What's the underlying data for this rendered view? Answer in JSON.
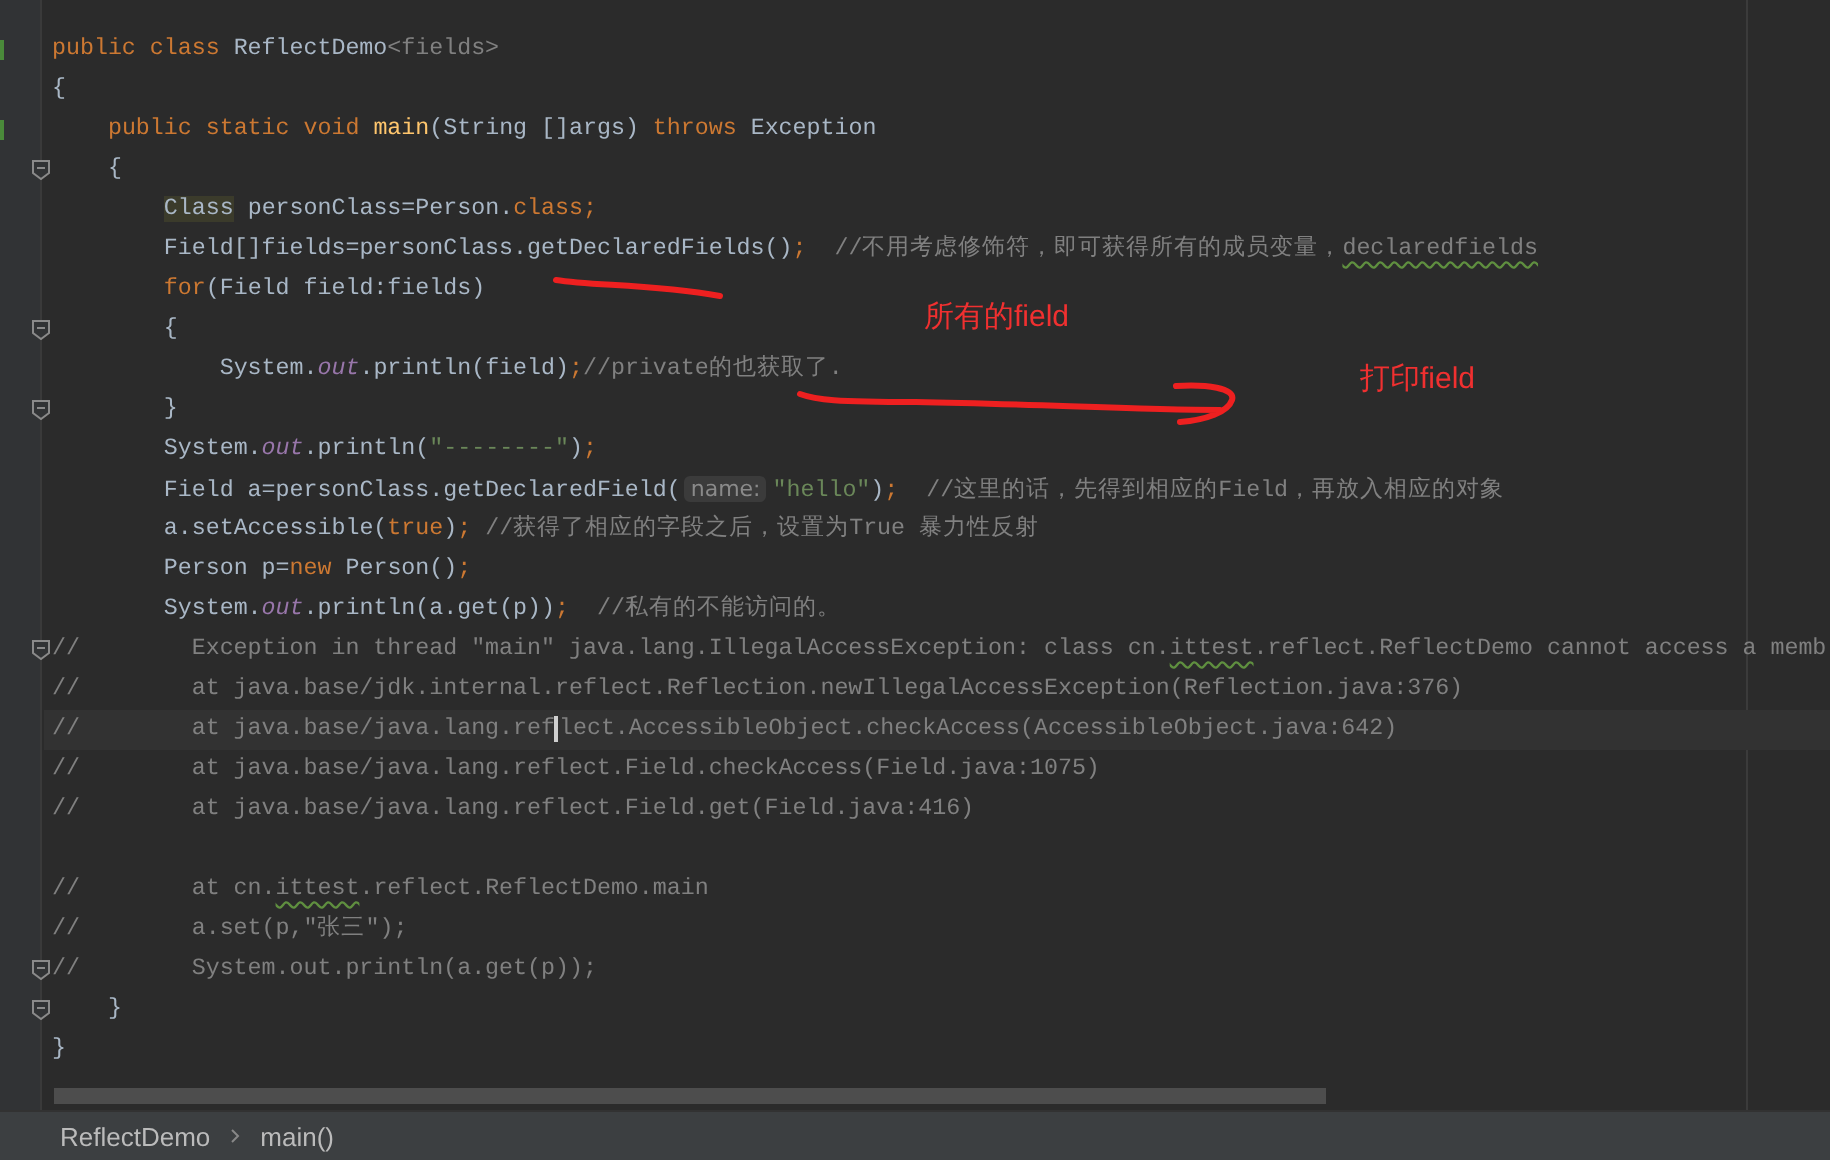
{
  "editor": {
    "lines": [
      {
        "run": true,
        "tokens": [
          {
            "text": "public class ",
            "kind": "kw"
          },
          {
            "text": "ReflectDemo",
            "kind": "plain"
          },
          {
            "text": "<fields>",
            "kind": "param"
          }
        ]
      },
      {
        "tokens": [
          {
            "text": "{",
            "kind": "plain"
          }
        ]
      },
      {
        "run": true,
        "tokens": [
          {
            "text": "    public static void ",
            "kind": "kw"
          },
          {
            "text": "main",
            "kind": "decl"
          },
          {
            "text": "(String []args) ",
            "kind": "plain"
          },
          {
            "text": "throws ",
            "kind": "kw"
          },
          {
            "text": "Exception",
            "kind": "plain"
          }
        ]
      },
      {
        "fold": true,
        "tokens": [
          {
            "text": "    {",
            "kind": "plain"
          }
        ]
      },
      {
        "tokens": [
          {
            "text": "        Class",
            "kind": "hl"
          },
          {
            "text": " personClass=Person.",
            "kind": "plain"
          },
          {
            "text": "class;",
            "kind": "kw"
          }
        ]
      },
      {
        "tokens": [
          {
            "text": "        Field[]fields=personClass.getDeclaredFields()",
            "kind": "plain"
          },
          {
            "text": ";  ",
            "kind": "kw"
          },
          {
            "text": "//不用考虑修饰符，即可获得所有的成员变量，",
            "kind": "cmt"
          },
          {
            "text": "declaredfields",
            "kind": "typo"
          }
        ]
      },
      {
        "tokens": [
          {
            "text": "        for",
            "kind": "kw"
          },
          {
            "text": "(Field field:fields)",
            "kind": "plain"
          }
        ]
      },
      {
        "fold": true,
        "tokens": [
          {
            "text": "        {",
            "kind": "plain"
          }
        ]
      },
      {
        "tokens": [
          {
            "text": "            System.",
            "kind": "plain"
          },
          {
            "text": "out",
            "kind": "static"
          },
          {
            "text": ".println(field)",
            "kind": "plain"
          },
          {
            "text": ";",
            "kind": "kw"
          },
          {
            "text": "//private的也获取了.",
            "kind": "cmt"
          }
        ]
      },
      {
        "fold": true,
        "tokens": [
          {
            "text": "        }",
            "kind": "plain"
          }
        ]
      },
      {
        "tokens": [
          {
            "text": "        System.",
            "kind": "plain"
          },
          {
            "text": "out",
            "kind": "static"
          },
          {
            "text": ".println(",
            "kind": "plain"
          },
          {
            "text": "\"--------\"",
            "kind": "str"
          },
          {
            "text": ")",
            "kind": "plain"
          },
          {
            "text": ";",
            "kind": "kw"
          }
        ]
      },
      {
        "tokens": [
          {
            "text": "        Field a=personClass.getDeclaredField(",
            "kind": "plain"
          },
          {
            "text": "name:",
            "kind": "hint"
          },
          {
            "text": "\"hello\"",
            "kind": "str"
          },
          {
            "text": ")",
            "kind": "plain"
          },
          {
            "text": ";  ",
            "kind": "kw"
          },
          {
            "text": "//这里的话，先得到相应的Field，再放入相应的对象",
            "kind": "cmt"
          }
        ]
      },
      {
        "tokens": [
          {
            "text": "        a.setAccessible(",
            "kind": "plain"
          },
          {
            "text": "true",
            "kind": "kw"
          },
          {
            "text": ")",
            "kind": "plain"
          },
          {
            "text": "; ",
            "kind": "kw"
          },
          {
            "text": "//获得了相应的字段之后，设置为True 暴力性反射",
            "kind": "cmt"
          }
        ]
      },
      {
        "tokens": [
          {
            "text": "        Person p=",
            "kind": "plain"
          },
          {
            "text": "new",
            "kind": "kw"
          },
          {
            "text": " Person()",
            "kind": "plain"
          },
          {
            "text": ";",
            "kind": "kw"
          }
        ]
      },
      {
        "tokens": [
          {
            "text": "        System.",
            "kind": "plain"
          },
          {
            "text": "out",
            "kind": "static"
          },
          {
            "text": ".println(a.get(p))",
            "kind": "plain"
          },
          {
            "text": ";  ",
            "kind": "kw"
          },
          {
            "text": "//私有的不能访问的。",
            "kind": "cmt"
          }
        ]
      },
      {
        "fold": true,
        "tokens": [
          {
            "text": "//        Exception in thread \"main\" java.lang.IllegalAccessException: class cn.",
            "kind": "cmt"
          },
          {
            "text": "ittest",
            "kind": "typo"
          },
          {
            "text": ".reflect.ReflectDemo cannot access a memb",
            "kind": "cmt"
          }
        ]
      },
      {
        "tokens": [
          {
            "text": "//        at java.base/jdk.internal.reflect.Reflection.newIllegalAccessException(Reflection.java:376)",
            "kind": "cmt"
          }
        ]
      },
      {
        "current": true,
        "tokens": [
          {
            "text": "//        at java.base/java.lang.ref",
            "kind": "cmt"
          },
          {
            "text": "lect.AccessibleObject.checkAccess(AccessibleObject.java:642)",
            "kind": "cmt",
            "caret_before": true
          }
        ]
      },
      {
        "tokens": [
          {
            "text": "//        at java.base/java.lang.reflect.Field.checkAccess(Field.java:1075)",
            "kind": "cmt"
          }
        ]
      },
      {
        "tokens": [
          {
            "text": "//        at java.base/java.lang.reflect.Field.get(Field.java:416)",
            "kind": "cmt"
          }
        ]
      },
      {
        "gap_before": true,
        "tokens": [
          {
            "text": "//        at cn.",
            "kind": "cmt"
          },
          {
            "text": "ittest",
            "kind": "typo"
          },
          {
            "text": ".reflect.ReflectDemo.main",
            "kind": "cmt"
          }
        ]
      },
      {
        "tokens": [
          {
            "text": "//        a.set(p,\"张三\");",
            "kind": "cmt"
          }
        ]
      },
      {
        "fold": true,
        "tokens": [
          {
            "text": "//        System.out.println(a.get(p));",
            "kind": "cmt"
          }
        ]
      },
      {
        "fold": true,
        "tokens": [
          {
            "text": "    }",
            "kind": "plain"
          }
        ]
      },
      {
        "tokens": [
          {
            "text": "}",
            "kind": "plain"
          }
        ]
      }
    ],
    "annotations": [
      {
        "text": "所有的field"
      },
      {
        "text": "打印field"
      }
    ]
  },
  "breadcrumbs": [
    {
      "label": "ReflectDemo"
    },
    {
      "label": "main()"
    }
  ]
}
